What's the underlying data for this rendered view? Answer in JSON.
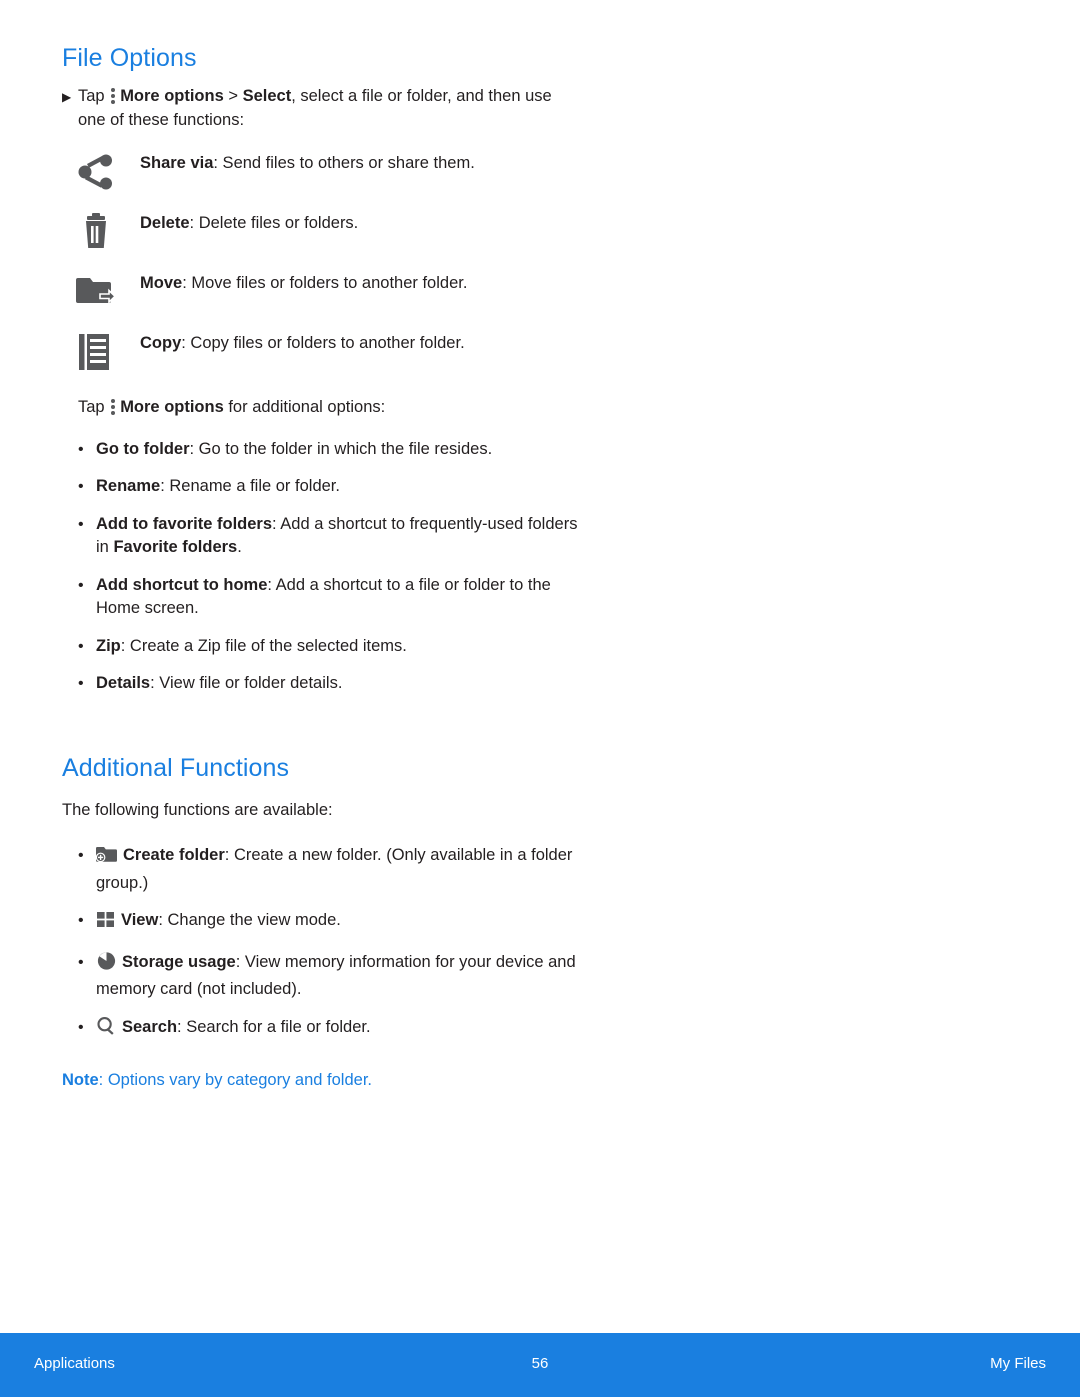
{
  "page": {
    "section1_title": "File Options",
    "section2_title": "Additional Functions"
  },
  "intro": {
    "tap_label": "Tap ",
    "more_options": "More options",
    "gt_select": " > ",
    "select": "Select",
    "rest": ", select a file or folder, and then use one of these functions:"
  },
  "icon_items": [
    {
      "icon": "share-icon",
      "bold": "Share via",
      "rest": ": Send files to others or share them."
    },
    {
      "icon": "trash-icon",
      "bold": "Delete",
      "rest": ": Delete files or folders."
    },
    {
      "icon": "move-folder-icon",
      "bold": "Move",
      "rest": ": Move files or folders to another folder."
    },
    {
      "icon": "copy-icon",
      "bold": "Copy",
      "rest": ": Copy files or folders to another folder."
    }
  ],
  "more_options_line": {
    "tap": "Tap ",
    "bold": "More options",
    "rest": " for additional options:"
  },
  "more_options_list": [
    {
      "bold": "Go to folder",
      "rest": ": Go to the folder in which the file resides."
    },
    {
      "bold": "Rename",
      "rest": ": Rename a file or folder."
    },
    {
      "bold": "Add to favorite folders",
      "rest": ": Add a shortcut to frequently-used folders in ",
      "bold2": "Favorite folders",
      "rest2": "."
    },
    {
      "bold": "Add shortcut to home",
      "rest": ": Add a shortcut to a file or folder to the Home screen."
    },
    {
      "bold": "Zip",
      "rest": ": Create a Zip file of the selected items."
    },
    {
      "bold": "Details",
      "rest": ": View file or folder details."
    }
  ],
  "additional": {
    "intro": "The following functions are available:",
    "items": [
      {
        "icon": "create-folder-icon",
        "bold": "Create folder",
        "rest": ": Create a new folder. (Only available in a folder group.)"
      },
      {
        "icon": "view-grid-icon",
        "bold": "View",
        "rest": ": Change the view mode."
      },
      {
        "icon": "storage-usage-icon",
        "bold": "Storage usage",
        "rest": ": View memory information for your device and memory card (not included)."
      },
      {
        "icon": "search-icon",
        "bold": "Search",
        "rest": ": Search for a file or folder."
      }
    ]
  },
  "note": {
    "label": "Note",
    "text": ": Options vary by category and folder."
  },
  "footer": {
    "left": "Applications",
    "page_number": "56",
    "right": "My Files"
  },
  "colors": {
    "accent": "#1a7fe0",
    "icon_gray": "#58595b",
    "body_text": "#231f20"
  }
}
